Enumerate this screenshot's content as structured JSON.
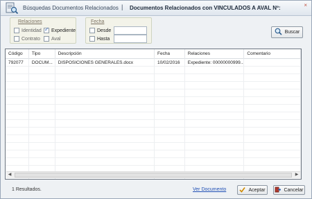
{
  "window": {
    "title": "Búsquedas Documentos Relacionados",
    "separator": "|",
    "subtitle": "Documentos Relacionados con VINCULADOS A AVAL Nº:",
    "close": "×"
  },
  "filters": {
    "relaciones": {
      "legend": "Relaciones",
      "options": [
        {
          "label": "Identidad",
          "checked": false
        },
        {
          "label": "Expediente",
          "checked": true
        },
        {
          "label": "Contrato",
          "checked": false
        },
        {
          "label": "Aval",
          "checked": false
        }
      ]
    },
    "fecha": {
      "legend": "Fecha",
      "desde_label": "Desde",
      "hasta_label": "Hasta",
      "desde_value": "",
      "hasta_value": ""
    }
  },
  "buttons": {
    "buscar": "Buscar",
    "aceptar": "Aceptar",
    "cancelar": "Cancelar"
  },
  "table": {
    "columns": [
      "Código",
      "Tipo",
      "Descripción",
      "Fecha",
      "Relaciones",
      "Comentario"
    ],
    "rows": [
      [
        "792077",
        "DOCUM...",
        "DISPOSICIONES GENERALES.docx",
        "10/02/2016",
        "Expediente: 00000000999...",
        ""
      ]
    ],
    "empty_rows": 16
  },
  "footer": {
    "status": "1 Resultados.",
    "link": "Ver Documento"
  },
  "colors": {
    "accent": "#2a5fb0",
    "link": "#1f4fb5"
  }
}
